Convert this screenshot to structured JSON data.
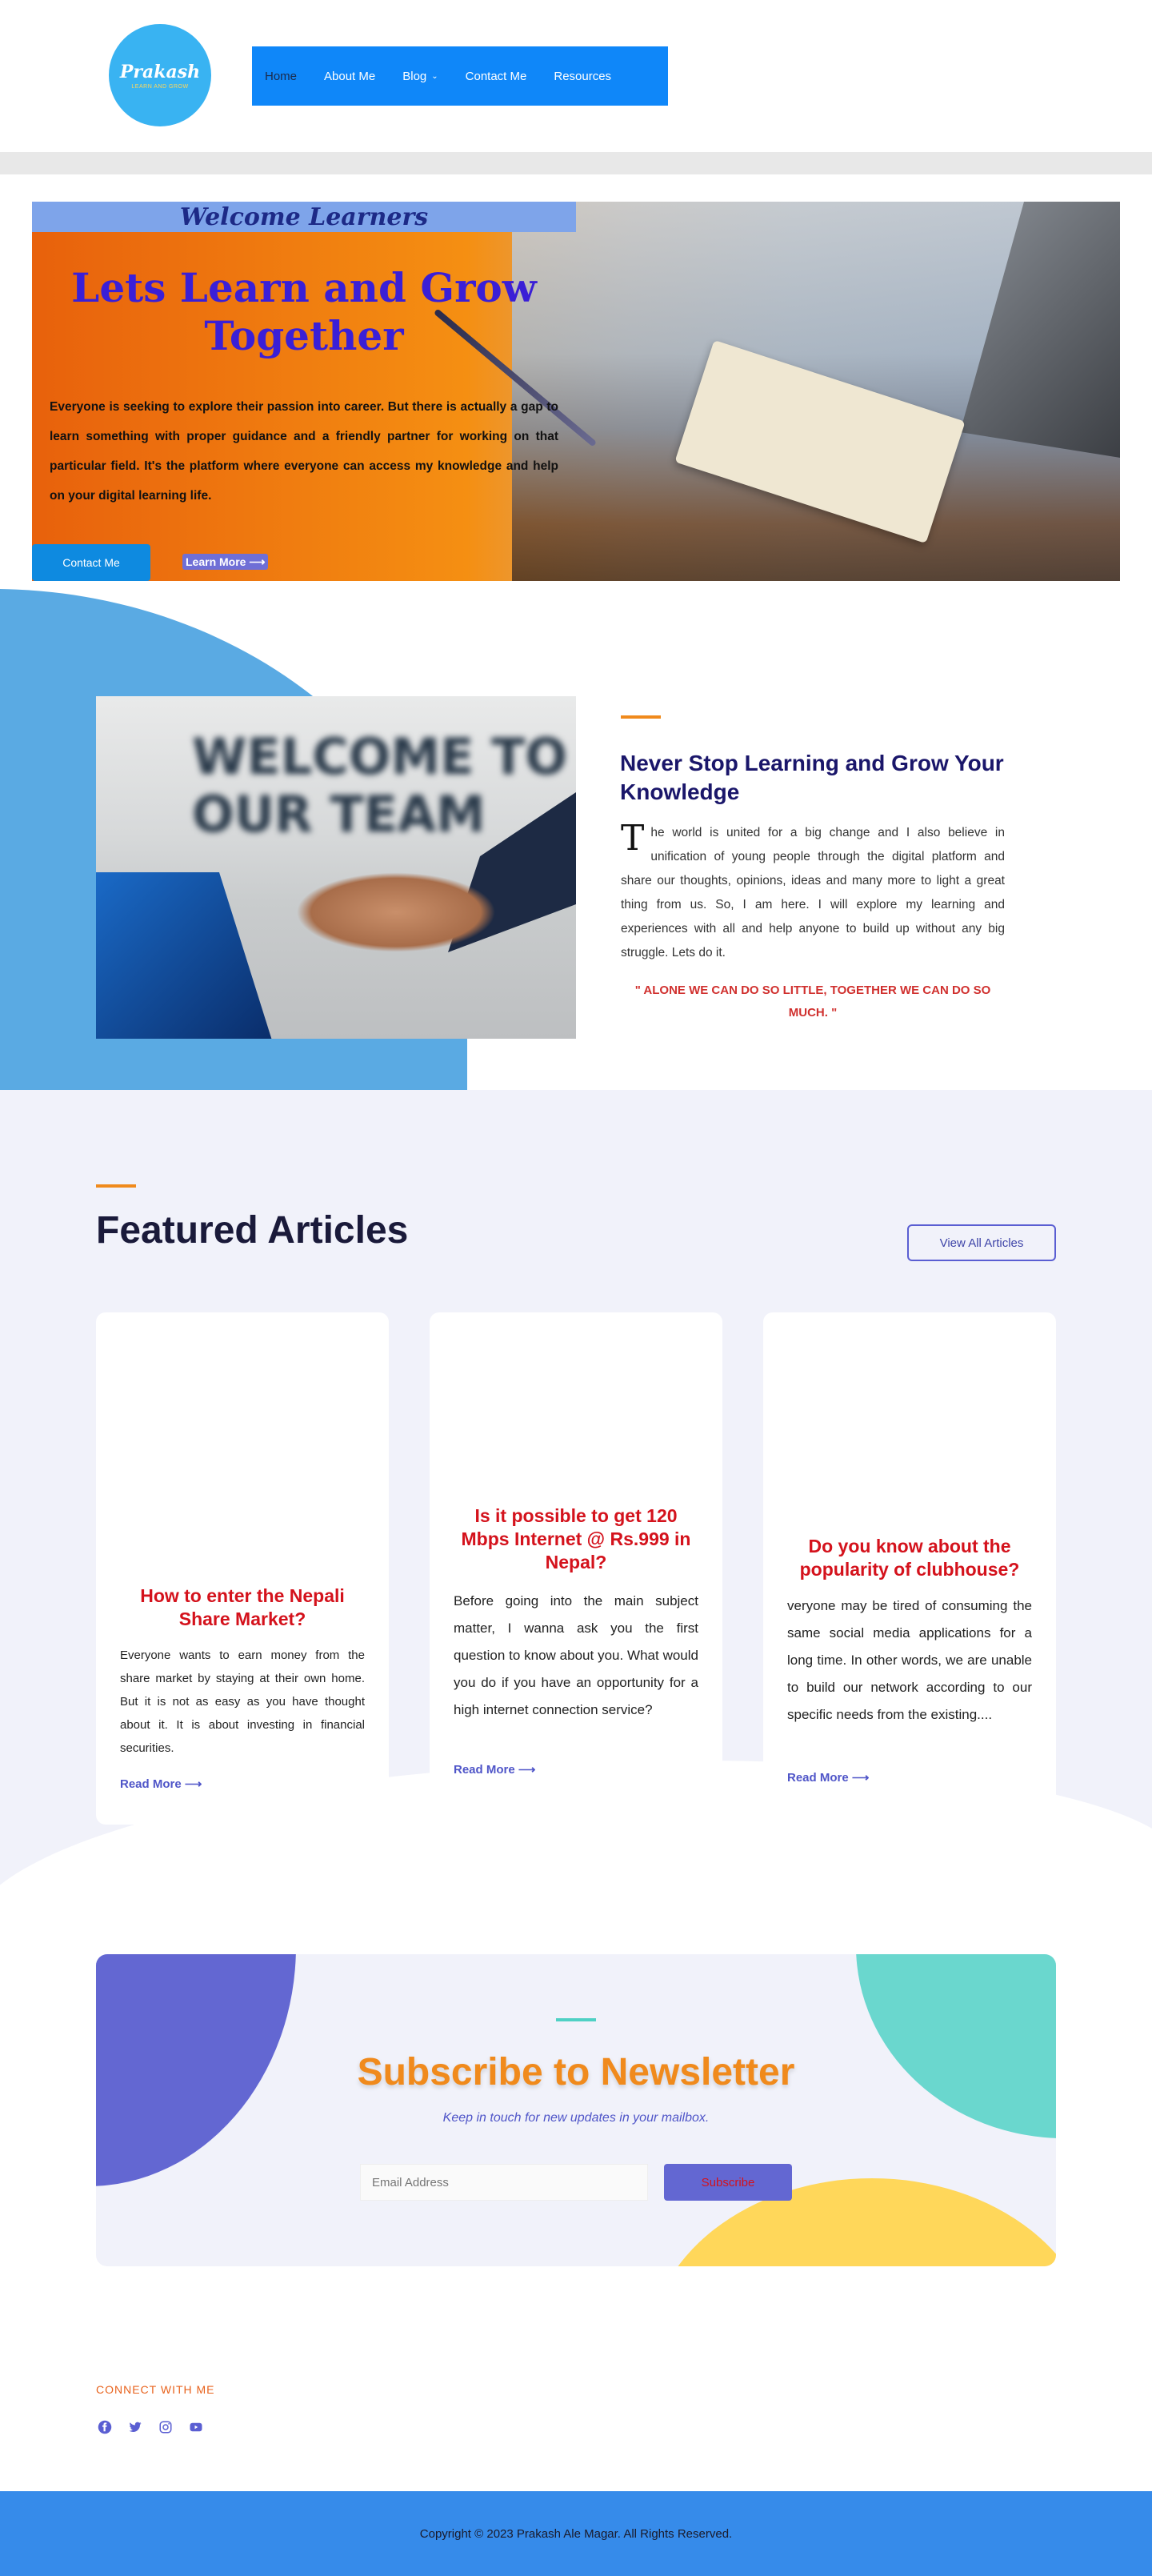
{
  "header": {
    "logo_text": "Prakash",
    "logo_sub": "LEARN AND GROW",
    "nav": [
      {
        "label": "Home"
      },
      {
        "label": "About Me"
      },
      {
        "label": "Blog"
      },
      {
        "label": "Contact Me"
      },
      {
        "label": "Resources"
      }
    ]
  },
  "hero": {
    "strip_text": "Welcome Learners",
    "title": "Lets Learn and Grow Together",
    "paragraph": "Everyone is seeking to explore their passion into career. But there is actually a gap to learn something with proper guidance and a friendly partner for working on that particular field. It's the platform where everyone can access my knowledge and help on your digital learning life.",
    "contact_button": "Contact Me",
    "learn_more": "Learn More ⟶"
  },
  "about": {
    "image_text": "WELCOME TO OUR TEAM",
    "title": "Never Stop Learning and Grow Your Knowledge",
    "dropcap": "T",
    "body": "he world is united for a big change and I also believe in unification of young people through the digital platform and share our thoughts, opinions, ideas and many more to light a great thing from us. So, I am here. I will explore my learning and experiences with all and help anyone to build up without any big struggle. Lets do it.",
    "quote": "\" ALONE WE CAN DO SO LITTLE, TOGETHER WE CAN DO SO MUCH. \""
  },
  "featured": {
    "title": "Featured Articles",
    "view_all": "View All Articles",
    "cards": [
      {
        "title": "How to enter the Nepali Share Market?",
        "body": "Everyone wants to earn money from the share market by staying at their own home. But it is not as easy as you have thought about it. It is about investing in financial securities.",
        "more": "Read More ⟶"
      },
      {
        "title": "Is it possible to get 120 Mbps Internet @ Rs.999 in Nepal?",
        "body": "Before going into the main subject matter, I wanna ask you the first question to know about you. What would you do if you have an opportunity for a high internet connection service?",
        "more": "Read More ⟶"
      },
      {
        "title": "Do you know about the popularity of clubhouse?",
        "body": "veryone may be tired of consuming the same social media applications for a long time. In other words, we are unable to build our network according to our specific needs from the existing....",
        "more": "Read More ⟶"
      }
    ]
  },
  "newsletter": {
    "title": "Subscribe to Newsletter",
    "subtitle": "Keep in touch for new updates in your mailbox.",
    "placeholder": "Email Address",
    "button": "Subscribe"
  },
  "connect": {
    "label": "CONNECT WITH ME",
    "icons": [
      "facebook-icon",
      "twitter-icon",
      "instagram-icon",
      "youtube-icon"
    ]
  },
  "footer": {
    "copyright": "Copyright © 2023 Prakash Ale Magar. All Rights Reserved."
  },
  "colors": {
    "nav_bg": "#0f87f9",
    "accent_orange": "#f08a1c",
    "article_title_red": "#d4121c",
    "link_purple": "#4f55c8",
    "footer_bg": "#368bea"
  }
}
